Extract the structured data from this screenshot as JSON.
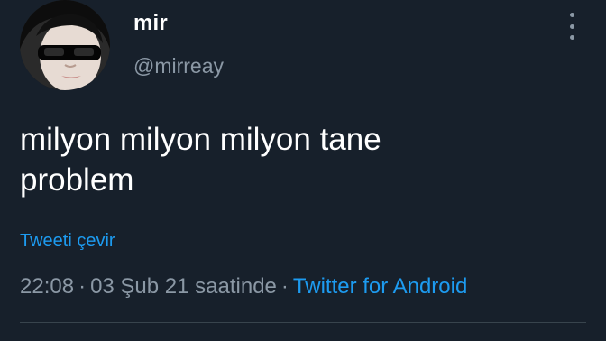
{
  "tweet": {
    "display_name": "mir",
    "handle": "@mirreay",
    "text_line1": "milyon milyon milyon tane",
    "text_line2": "problem",
    "translate_label": "Tweeti çevir",
    "time": "22:08",
    "separator": "·",
    "date": "03 Şub 21 saatinde",
    "source": "Twitter for Android"
  },
  "icons": {
    "avatar": "profile-photo",
    "more": "more-vertical-icon"
  },
  "colors": {
    "background": "#17202b",
    "text": "#ffffff",
    "secondary": "#8b98a5",
    "accent": "#1d9bf0"
  }
}
